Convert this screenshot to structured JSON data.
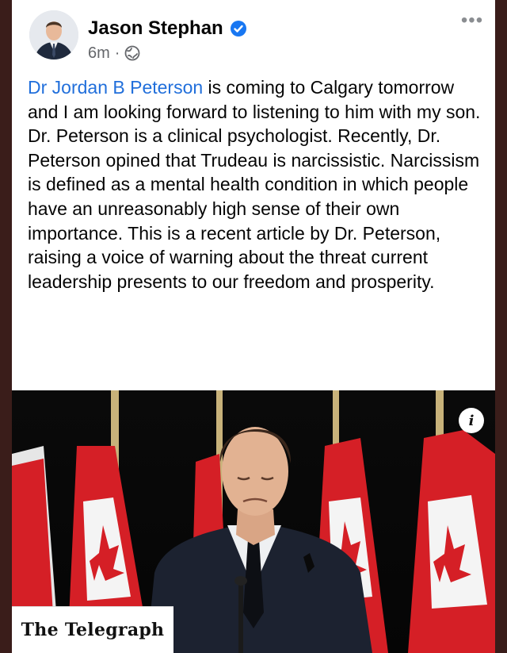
{
  "post": {
    "author": "Jason Stephan",
    "time": "6m",
    "separator": "·",
    "mention": "Dr Jordan B Peterson",
    "body": " is coming to Calgary tomorrow and I am looking forward to listening to him with my son.  Dr. Peterson is a clinical psychologist.   Recently, Dr. Peterson opined that Trudeau is narcissistic.  Narcissism is defined as a mental health condition in which people have an unreasonably high sense of their own importance.  This is a recent article by Dr. Peterson, raising a voice of warning about the threat current leadership presents to our freedom and prosperity.",
    "more_label": "•••"
  },
  "link_preview": {
    "publisher": "The Telegraph",
    "info_label": "i"
  },
  "icons": {
    "verified": "verified-badge-icon",
    "audience": "globe-icon",
    "more": "more-options-icon",
    "info": "info-icon"
  },
  "colors": {
    "link": "#216fdb",
    "verified": "#1877f2",
    "meta_text": "#65676b",
    "flag_red": "#d51f26"
  }
}
